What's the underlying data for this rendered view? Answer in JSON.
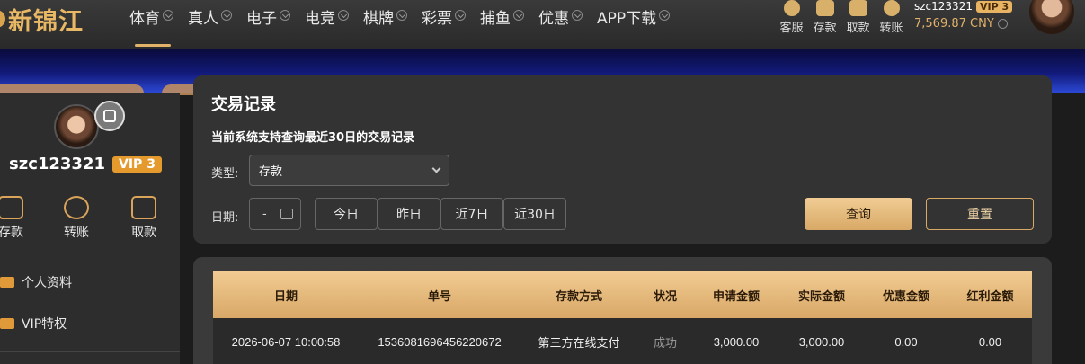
{
  "brand": {
    "logo_text": "新锦江"
  },
  "nav": [
    {
      "label": "体育",
      "active": true
    },
    {
      "label": "真人"
    },
    {
      "label": "电子"
    },
    {
      "label": "电竞"
    },
    {
      "label": "棋牌"
    },
    {
      "label": "彩票"
    },
    {
      "label": "捕鱼"
    },
    {
      "label": "优惠"
    },
    {
      "label": "APP下载"
    }
  ],
  "header_tools": [
    {
      "label": "客服",
      "icon": "service-icon"
    },
    {
      "label": "存款",
      "icon": "deposit-icon"
    },
    {
      "label": "取款",
      "icon": "withdraw-icon"
    },
    {
      "label": "转账",
      "icon": "transfer-icon"
    }
  ],
  "user": {
    "username": "szc123321",
    "vip_label": "VIP 3",
    "balance": "7,569.87 CNY"
  },
  "sidebar": {
    "username": "szc123321",
    "vip_label": "VIP 3",
    "quick_actions": [
      {
        "label": "存款"
      },
      {
        "label": "转账"
      },
      {
        "label": "取款"
      }
    ],
    "menu": [
      {
        "label": "个人资料"
      },
      {
        "label": "VIP特权"
      }
    ]
  },
  "search": {
    "title": "交易记录",
    "notice": "当前系统支持查询最近30日的交易记录",
    "type_label": "类型:",
    "type_value": "存款",
    "date_label": "日期:",
    "date_value": "-",
    "ranges": [
      "今日",
      "昨日",
      "近7日",
      "近30日"
    ],
    "query_label": "查询",
    "reset_label": "重置"
  },
  "table": {
    "columns": [
      "日期",
      "单号",
      "存款方式",
      "状况",
      "申请金额",
      "实际金额",
      "优惠金额",
      "红利金额"
    ],
    "rows": [
      [
        "2026-06-07 10:00:58",
        "1536081696456220672",
        "第三方在线支付",
        "成功",
        "3,000.00",
        "3,000.00",
        "0.00",
        "0.00"
      ]
    ]
  }
}
